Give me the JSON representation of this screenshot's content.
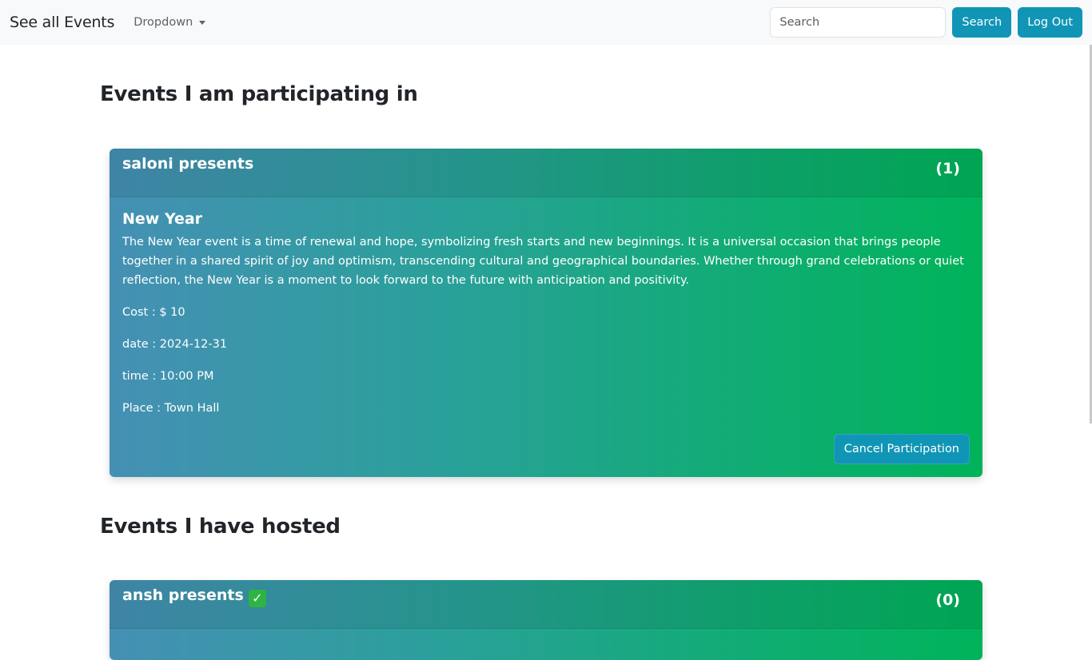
{
  "navbar": {
    "brand": "See all Events",
    "dropdown": "Dropdown",
    "search_placeholder": "Search",
    "search_button": "Search",
    "logout_button": "Log Out"
  },
  "sections": {
    "participating_title": "Events I am participating in",
    "hosted_title": "Events I have hosted"
  },
  "participating": {
    "host": "saloni presents",
    "count": "(1)",
    "title": "New Year",
    "description": "The New Year event is a time of renewal and hope, symbolizing fresh starts and new beginnings. It is a universal occasion that brings people together in a shared spirit of joy and optimism, transcending cultural and geographical boundaries. Whether through grand celebrations or quiet reflection, the New Year is a moment to look forward to the future with anticipation and positivity.",
    "cost": "Cost : $ 10",
    "date": "date : 2024-12-31",
    "time": "time : 10:00 PM",
    "place": "Place : Town Hall",
    "cancel_button": "Cancel Participation"
  },
  "hosted": {
    "host": "ansh presents",
    "verified_icon": "check-mark-icon",
    "count": "(0)"
  },
  "colors": {
    "accent": "#1195b6",
    "card_gradient_start": "#4590b4",
    "card_gradient_end": "#00b35a"
  }
}
